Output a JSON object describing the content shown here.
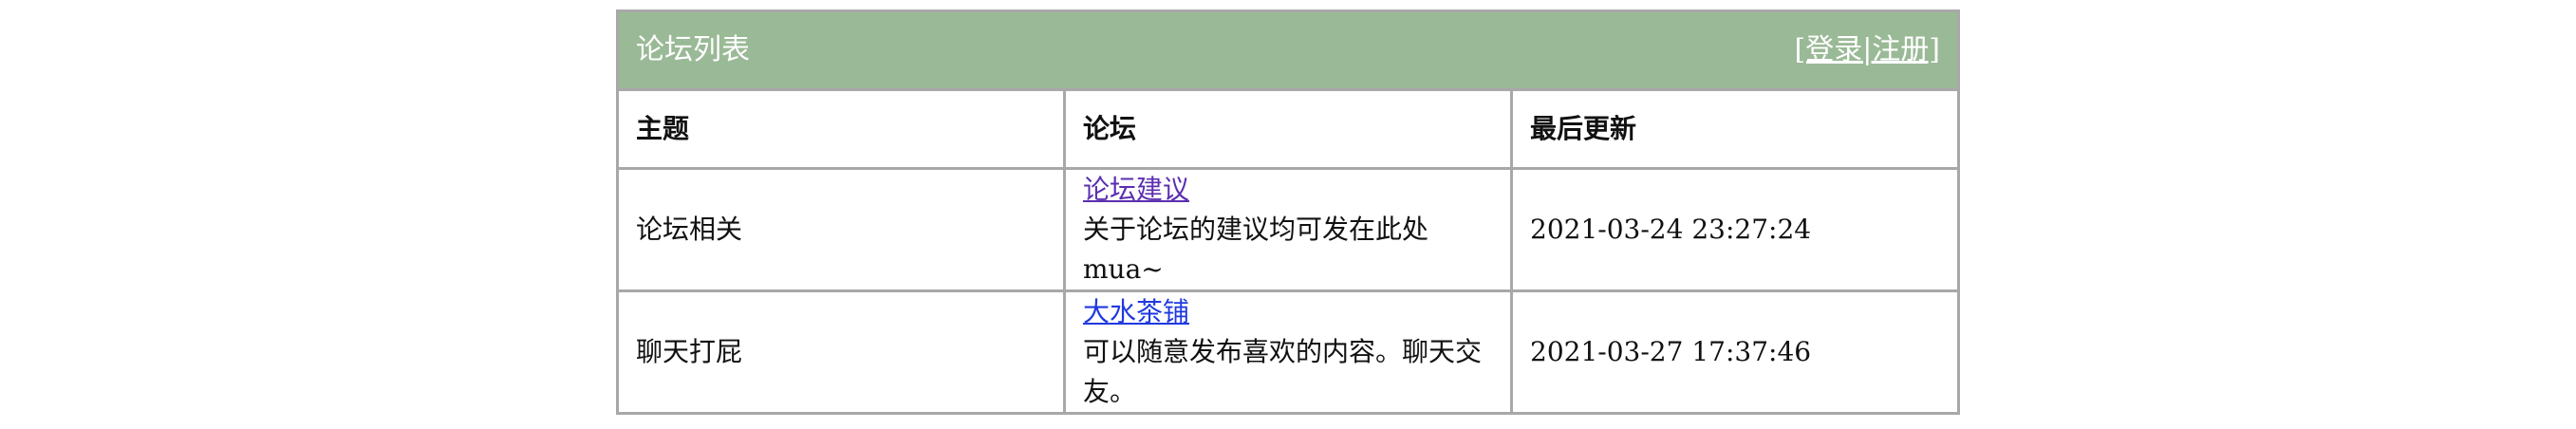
{
  "table": {
    "title": "论坛列表",
    "login_register": "[登录|注册]",
    "title_bar_color": "#9ab996",
    "headers": [
      "主题",
      "论坛",
      "最后更新"
    ],
    "rows": [
      {
        "topic": "论坛相关",
        "forum_name": "论坛建议",
        "forum_desc": "关于论坛的建议均可发在此处mua~",
        "last_update": "2021-03-24 23:27:24",
        "link_color": "#5b2fb0"
      },
      {
        "topic": "聊天打屁",
        "forum_name": "大水茶铺",
        "forum_desc": "可以随意发布喜欢的内容。聊天交友。",
        "last_update": "2021-03-27 17:37:46",
        "link_color": "#1f39e0"
      }
    ]
  }
}
